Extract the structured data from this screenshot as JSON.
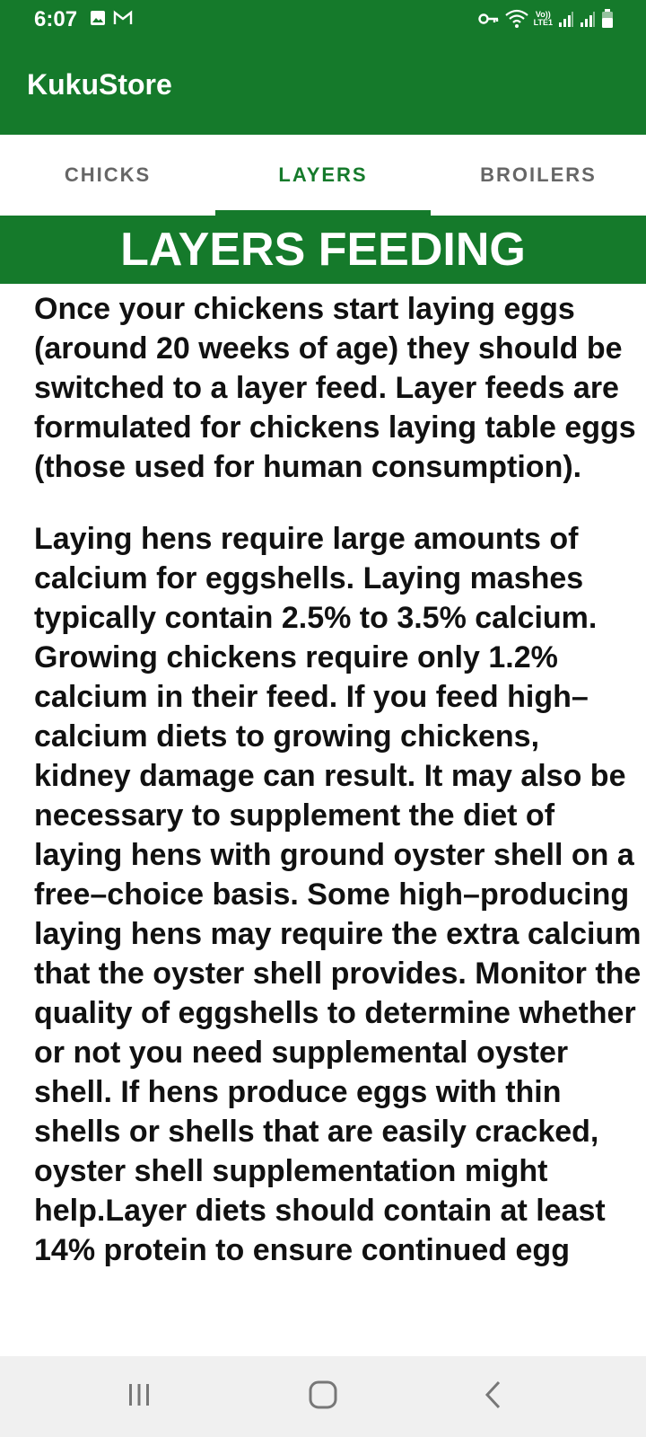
{
  "status_bar": {
    "time": "6:07",
    "lte_label_top": "Vo))",
    "lte_label_bottom": "LTE1",
    "icons": [
      "image-icon",
      "gmail-icon",
      "vpn-key-icon",
      "wifi-icon",
      "signal-icon",
      "signal-icon",
      "battery-icon"
    ]
  },
  "app_bar": {
    "title": "KukuStore"
  },
  "tabs": [
    {
      "label": "CHICKS",
      "active": false
    },
    {
      "label": "LAYERS",
      "active": true
    },
    {
      "label": "BROILERS",
      "active": false
    }
  ],
  "section": {
    "heading": "LAYERS FEEDING",
    "paragraphs": [
      "Once your chickens start laying eggs (around 20 weeks of age) they should be switched to a layer feed. Layer feeds are formulated for chickens laying table eggs (those used for human consumption).",
      "Laying hens require large amounts of calcium for eggshells. Laying mashes typically contain 2.5% to 3.5% calcium. Growing chickens require only 1.2% calcium in their feed. If you feed high–calcium diets to growing chickens, kidney damage can result. It may also be necessary to supplement the diet of laying hens with ground oyster shell on a free–choice basis. Some high–producing laying hens may require the extra calcium that the oyster shell provides. Monitor the quality of eggshells to determine whether or not you need supplemental oyster shell. If hens produce eggs with thin shells or shells that are easily cracked, oyster shell supplementation might help.Layer diets should contain at least 14% protein to ensure continued egg"
    ]
  },
  "colors": {
    "primary": "#157a2b",
    "tab_inactive": "#666666",
    "nav_bg": "#f0f0f0"
  },
  "nav_bar": {
    "buttons": [
      "recent-apps-icon",
      "home-icon",
      "back-icon"
    ]
  }
}
